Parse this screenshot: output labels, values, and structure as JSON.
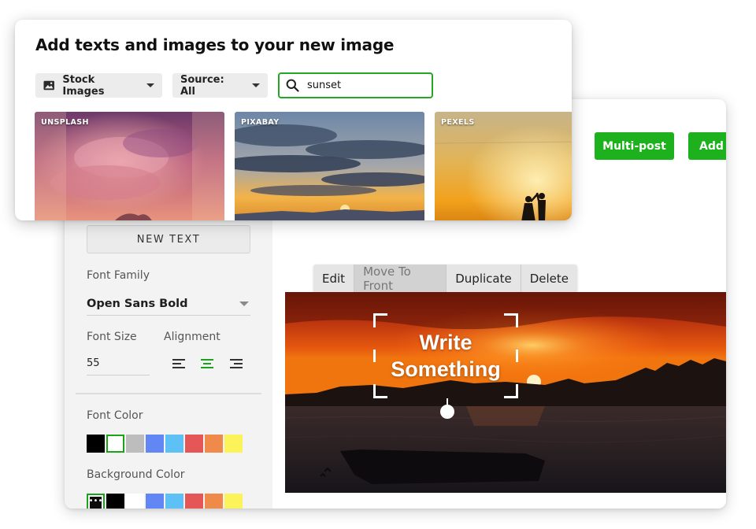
{
  "stock_panel": {
    "title": "Add texts and images to your new image",
    "source_type_label": "Stock Images",
    "source_filter_label": "Source: All",
    "search_value": "sunset",
    "thumbnails": [
      {
        "label": "UNSPLASH"
      },
      {
        "label": "PIXABAY"
      },
      {
        "label": "PEXELS"
      }
    ]
  },
  "editor": {
    "buttons": {
      "multi_post": "Multi-post",
      "add": "Add t"
    },
    "new_text_label": "NEW TEXT",
    "font_family_label": "Font Family",
    "font_family_value": "Open Sans Bold",
    "font_size_label": "Font Size",
    "font_size_value": "55",
    "alignment_label": "Alignment",
    "alignment_selected": "center",
    "font_color_label": "Font Color",
    "background_color_label": "Background Color",
    "font_colors": [
      "#000000",
      "#ffffff",
      "#bdbdbd",
      "#6286f4",
      "#5ec1f6",
      "#e55757",
      "#f08a4b",
      "#fcf25a"
    ],
    "background_colors": [
      "#0c0c0c",
      "#000000",
      "#ffffff",
      "#6286f4",
      "#5ec1f6",
      "#e55757",
      "#f08a4b",
      "#fcf25a"
    ],
    "toolbar": {
      "edit": "Edit",
      "move_to_front": "Move To Front",
      "duplicate": "Duplicate",
      "delete": "Delete"
    },
    "canvas_text_line1": "Write",
    "canvas_text_line2": "Something",
    "accent_color": "#1db11d"
  }
}
